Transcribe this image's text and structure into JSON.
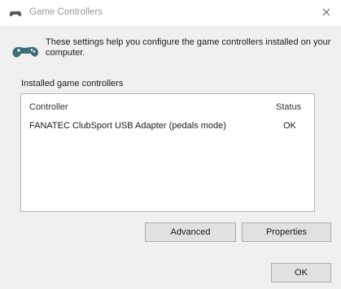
{
  "window": {
    "title": "Game Controllers",
    "close_glyph": "×",
    "icons": {
      "app": "game-controller-icon",
      "close": "close-icon"
    }
  },
  "description": "These settings help you configure the game controllers installed on your computer.",
  "group_label": "Installed game controllers",
  "list": {
    "columns": [
      "Controller",
      "Status"
    ],
    "rows": [
      {
        "controller": "FANATEC ClubSport USB Adapter (pedals mode)",
        "status": "OK"
      }
    ]
  },
  "buttons": {
    "advanced": "Advanced",
    "properties": "Properties",
    "ok": "OK"
  }
}
